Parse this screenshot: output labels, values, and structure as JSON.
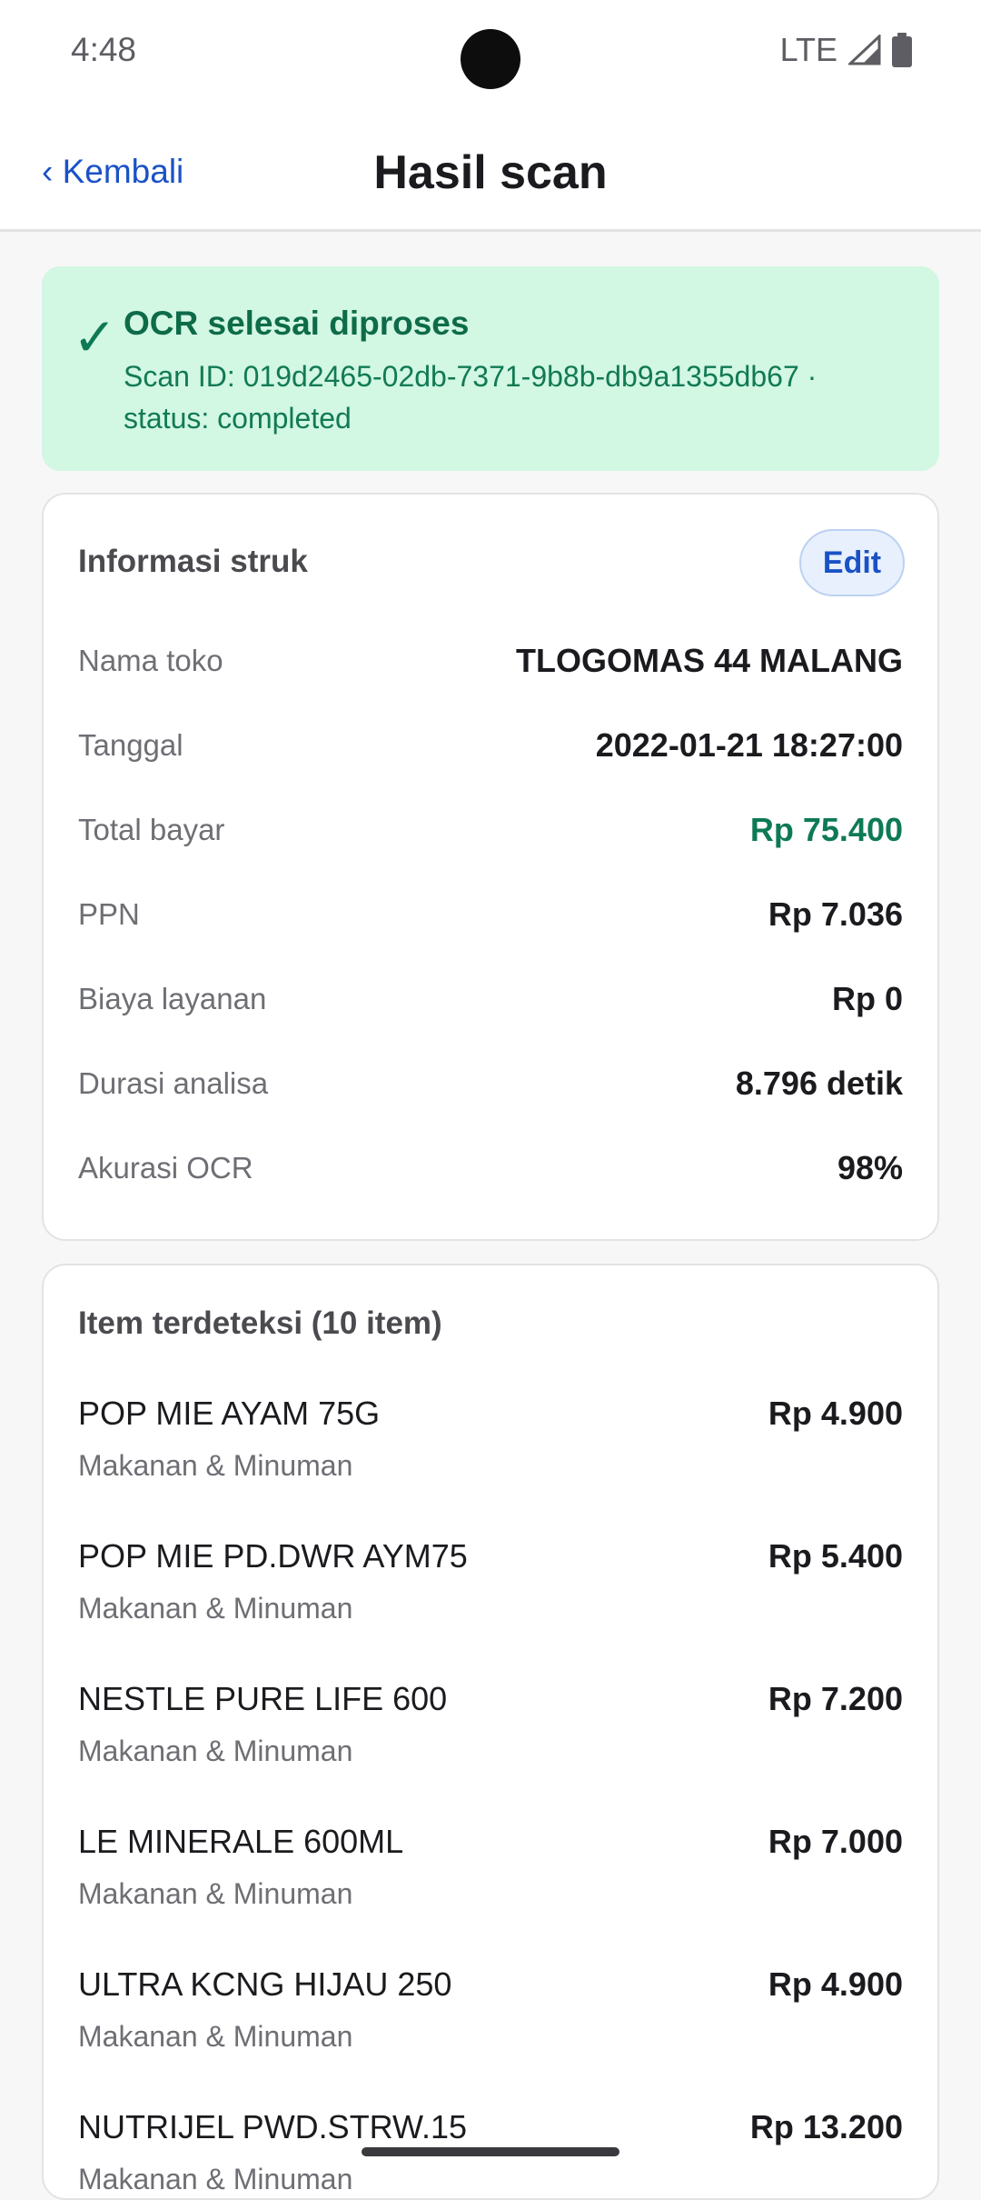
{
  "status_bar": {
    "time": "4:48",
    "network": "LTE"
  },
  "header": {
    "back_label": "‹ Kembali",
    "title": "Hasil scan"
  },
  "banner": {
    "title": "OCR selesai diproses",
    "subtitle": "Scan ID: 019d2465-02db-7371-9b8b-db9a1355db67 · status: completed"
  },
  "receipt_info": {
    "title": "Informasi struk",
    "edit_label": "Edit",
    "rows": [
      {
        "label": "Nama toko",
        "value": "TLOGOMAS 44 MALANG"
      },
      {
        "label": "Tanggal",
        "value": "2022-01-21 18:27:00"
      },
      {
        "label": "Total bayar",
        "value": "Rp 75.400"
      },
      {
        "label": "PPN",
        "value": "Rp 7.036"
      },
      {
        "label": "Biaya layanan",
        "value": "Rp 0"
      },
      {
        "label": "Durasi analisa",
        "value": "8.796 detik"
      },
      {
        "label": "Akurasi OCR",
        "value": "98%"
      }
    ]
  },
  "items_section": {
    "title": "Item terdeteksi (10 item)",
    "items": [
      {
        "name": "POP MIE AYAM 75G",
        "category": "Makanan & Minuman",
        "price": "Rp 4.900"
      },
      {
        "name": "POP MIE PD.DWR AYM75",
        "category": "Makanan & Minuman",
        "price": "Rp 5.400"
      },
      {
        "name": "NESTLE PURE LIFE 600",
        "category": "Makanan & Minuman",
        "price": "Rp 7.200"
      },
      {
        "name": "LE MINERALE 600ML",
        "category": "Makanan & Minuman",
        "price": "Rp 7.000"
      },
      {
        "name": "ULTRA KCNG HIJAU 250",
        "category": "Makanan & Minuman",
        "price": "Rp 4.900"
      },
      {
        "name": "NUTRIJEL PWD.STRW.15",
        "category": "Makanan & Minuman",
        "price": "Rp 13.200"
      }
    ]
  },
  "colors": {
    "accent": "#1a52c6",
    "success": "#0e7a55",
    "banner_bg": "#d2f7e2"
  }
}
